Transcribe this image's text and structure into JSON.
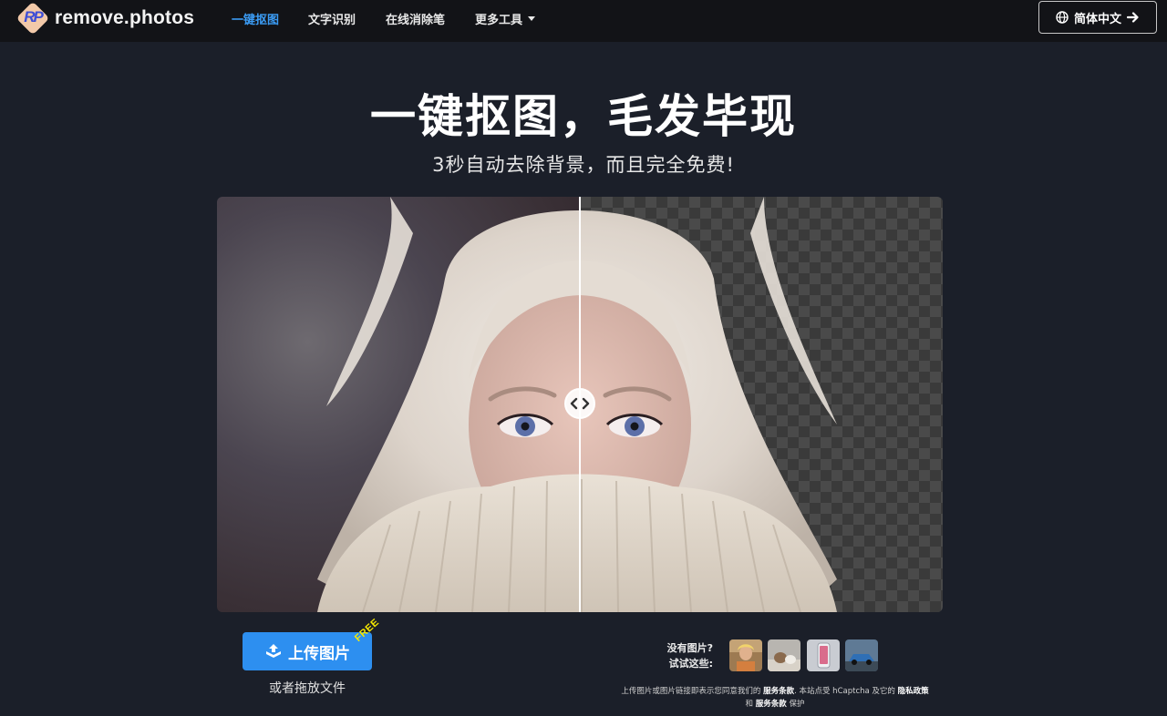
{
  "header": {
    "logo_text": "remove.photos",
    "logo_mark": "RP",
    "nav": [
      {
        "label": "一键抠图",
        "active": true
      },
      {
        "label": "文字识别",
        "active": false
      },
      {
        "label": "在线消除笔",
        "active": false
      },
      {
        "label": "更多工具",
        "active": false,
        "dropdown": true
      }
    ],
    "language_button": {
      "label": "简体中文",
      "icon": "globe-icon",
      "trailing_icon": "arrow-right-icon"
    }
  },
  "hero": {
    "title": "一键抠图，毛发毕现",
    "subtitle": "3秒自动去除背景，而且完全免费!"
  },
  "compare": {
    "handle_icon": "compare-arrows-icon",
    "divider_position": 0.5
  },
  "upload": {
    "button_label": "上传图片",
    "badge": "FREE",
    "drop_hint": "或者拖放文件"
  },
  "samples": {
    "line1": "没有图片?",
    "line2": "试试这些:",
    "thumbnails": [
      "sample-person-thumb",
      "sample-animal-thumb",
      "sample-phone-thumb",
      "sample-car-thumb"
    ]
  },
  "terms": {
    "prefix": "上传图片或图片链接即表示您同意我们的",
    "terms_link": "服务条款",
    "middle": ". 本站点受 hCaptcha 及它的",
    "privacy_link": "隐私政策",
    "and": "和",
    "terms_link2": "服务条款",
    "suffix": "保护"
  },
  "colors": {
    "background": "#1b1f29",
    "navbar": "#121317",
    "accent": "#2d8ff0",
    "active_nav": "#3b9cf5",
    "free_badge": "#f5e800"
  }
}
